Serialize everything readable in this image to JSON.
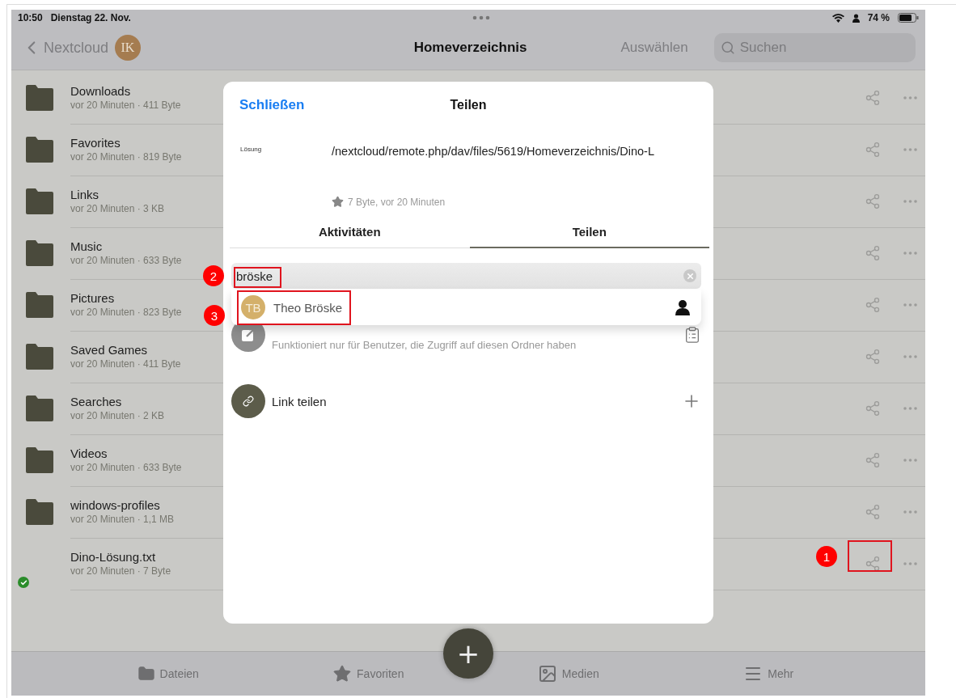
{
  "status_bar": {
    "time": "10:50",
    "date": "Dienstag 22. Nov.",
    "battery": "74 %"
  },
  "nav": {
    "back": "Nextcloud",
    "avatar": "IK",
    "title": "Homeverzeichnis",
    "select": "Auswählen",
    "search": {
      "placeholder": "Suchen"
    }
  },
  "files": [
    {
      "kind": "folder",
      "name": "Downloads",
      "meta": "vor 20 Minuten · 411 Byte",
      "synced": false
    },
    {
      "kind": "folder",
      "name": "Favorites",
      "meta": "vor 20 Minuten · 819 Byte",
      "synced": false
    },
    {
      "kind": "folder",
      "name": "Links",
      "meta": "vor 20 Minuten · 3 KB",
      "synced": false
    },
    {
      "kind": "folder",
      "name": "Music",
      "meta": "vor 20 Minuten · 633 Byte",
      "synced": false
    },
    {
      "kind": "folder",
      "name": "Pictures",
      "meta": "vor 20 Minuten · 823 Byte",
      "synced": false
    },
    {
      "kind": "folder",
      "name": "Saved Games",
      "meta": "vor 20 Minuten · 411 Byte",
      "synced": false
    },
    {
      "kind": "folder",
      "name": "Searches",
      "meta": "vor 20 Minuten · 2 KB",
      "synced": false
    },
    {
      "kind": "folder",
      "name": "Videos",
      "meta": "vor 20 Minuten · 633 Byte",
      "synced": false
    },
    {
      "kind": "folder",
      "name": "windows-profiles",
      "meta": "vor 20 Minuten · 1,1 MB",
      "synced": false
    },
    {
      "kind": "file",
      "name": "Dino-Lösung.txt",
      "meta": "vor 20 Minuten · 7 Byte",
      "synced": true
    }
  ],
  "share_sheet": {
    "close": "Schließen",
    "title": "Teilen",
    "preview_text": "Lösung",
    "path": "/nextcloud/remote.php/dav/files/5619/Homeverzeichnis/Dino-L",
    "details": "7 Byte, vor 20 Minuten",
    "tabs": [
      {
        "label": "Aktivitäten",
        "selected": false
      },
      {
        "label": "Teilen",
        "selected": true
      }
    ],
    "search": {
      "value": "bröske"
    },
    "suggestions": [
      {
        "initials": "TB",
        "name": "Theo Bröske"
      }
    ],
    "internal_note": "Funktioniert nur für Benutzer, die Zugriff auf diesen Ordner haben",
    "link_label": "Link teilen"
  },
  "fab": "+",
  "tab_bar": [
    {
      "kind": "files",
      "label": "Dateien"
    },
    {
      "kind": "favorites",
      "label": "Favoriten"
    },
    {
      "kind": "media",
      "label": "Medien"
    },
    {
      "kind": "more",
      "label": "Mehr"
    }
  ],
  "annotations": [
    {
      "label": "1"
    },
    {
      "label": "2"
    },
    {
      "label": "3"
    }
  ]
}
